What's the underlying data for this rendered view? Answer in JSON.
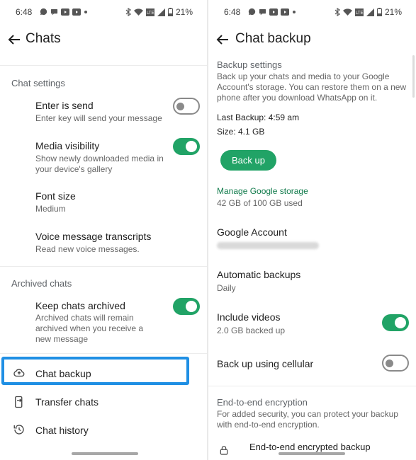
{
  "status_bar": {
    "time": "6:48",
    "battery": "21%",
    "left_icons": [
      "chat-bubble-icon",
      "message-icon",
      "youtube-icon",
      "youtube-icon",
      "dot-icon"
    ],
    "right_icons": [
      "bluetooth-icon",
      "wifi-icon",
      "signal-icon",
      "signal-icon",
      "battery-icon"
    ]
  },
  "chats_screen": {
    "title": "Chats",
    "chat_settings_header": "Chat settings",
    "enter_is_send": {
      "title": "Enter is send",
      "subtitle": "Enter key will send your message",
      "enabled": false
    },
    "media_visibility": {
      "title": "Media visibility",
      "subtitle": "Show newly downloaded media in your device's gallery",
      "enabled": true
    },
    "font_size": {
      "title": "Font size",
      "value": "Medium"
    },
    "voice_transcripts": {
      "title": "Voice message transcripts",
      "subtitle": "Read new voice messages."
    },
    "archived_header": "Archived chats",
    "keep_archived": {
      "title": "Keep chats archived",
      "subtitle": "Archived chats will remain archived when you receive a new message",
      "enabled": true
    },
    "chat_backup_label": "Chat backup",
    "transfer_chats_label": "Transfer chats",
    "chat_history_label": "Chat history",
    "highlight_color": "#1f8fe4"
  },
  "backup_screen": {
    "title": "Chat backup",
    "backup_settings_header": "Backup settings",
    "description": "Back up your chats and media to your Google Account's storage. You can restore them on a new phone after you download WhatsApp on it.",
    "last_backup": "Last Backup: 4:59 am",
    "size": "Size: 4.1 GB",
    "back_up_button": "Back up",
    "manage_storage_link": "Manage Google storage",
    "storage_used": "42 GB of 100 GB used",
    "google_account_title": "Google Account",
    "automatic_backups_title": "Automatic backups",
    "automatic_backups_value": "Daily",
    "include_videos": {
      "title": "Include videos",
      "subtitle": "2.0 GB backed up",
      "enabled": true
    },
    "cellular": {
      "title": "Back up using cellular",
      "enabled": false
    },
    "e2e_header": "End-to-end encryption",
    "e2e_description": "For added security, you can protect your backup with end-to-end encryption.",
    "e2e_item_partial": "End-to-end encrypted backup"
  },
  "colors": {
    "accent_green": "#21a366",
    "link_green": "#0f7a4a"
  }
}
